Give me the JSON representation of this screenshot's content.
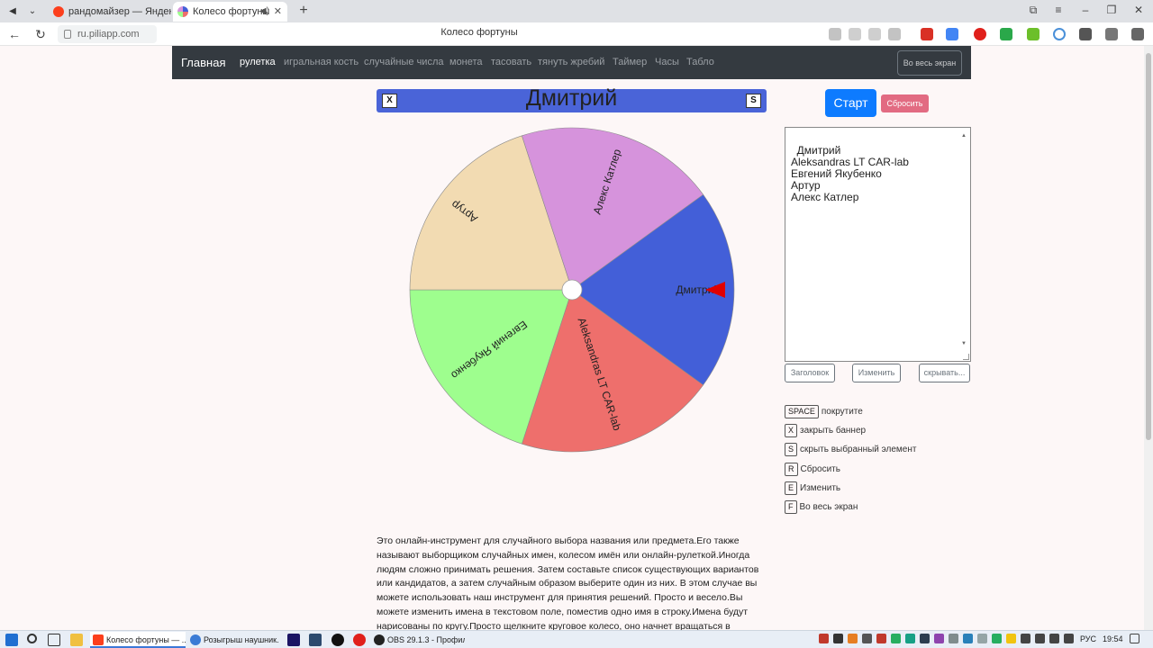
{
  "browser": {
    "tabs": [
      {
        "label": "рандомайзер — Яндекс: н"
      },
      {
        "label": "Колесо фортуны"
      }
    ],
    "url": "ru.piliapp.com",
    "page_title": "Колесо фортуны"
  },
  "nav": {
    "brand": "Главная",
    "links": [
      "рулетка",
      "игральная кость",
      "случайные числа",
      "монета",
      "тасовать",
      "тянуть жребий",
      "Таймер",
      "Часы",
      "Табло"
    ],
    "fullscreen": "Во весь экран"
  },
  "banner": {
    "close_key": "X",
    "winner": "Дмитрий",
    "hide_key": "S"
  },
  "wheel": {
    "segments": [
      {
        "name": "Дмитрий",
        "color": "#435fd8"
      },
      {
        "name": "Aleksandras LT CAR-lab",
        "color": "#ee6f6c"
      },
      {
        "name": "Евгений Якубенко",
        "color": "#9efe8e"
      },
      {
        "name": "Артур",
        "color": "#f2dbb2"
      },
      {
        "name": "Алекс Катлер",
        "color": "#d693dc"
      }
    ],
    "pointer_color": "#e00000"
  },
  "controls": {
    "start": "Старт",
    "reset": "Сбросить",
    "names_text": "Дмитрий\nAleksandras LT CAR-lab\nЕвгений Якубенко\nАртур\nАлекс Катлер",
    "title_btn": "Заголовок",
    "edit_btn": "Изменить",
    "hide_btn": "скрывать..."
  },
  "hotkeys": [
    {
      "key": "SPACE",
      "label": "покрутите"
    },
    {
      "key": "X",
      "label": "закрыть баннер"
    },
    {
      "key": "S",
      "label": "скрыть выбранный элемент"
    },
    {
      "key": "R",
      "label": "Сбросить"
    },
    {
      "key": "E",
      "label": "Изменить"
    },
    {
      "key": "F",
      "label": "Во весь экран"
    }
  ],
  "description": "Это онлайн-инструмент для случайного выбора названия или предмета.Его также называют выборщиком случайных имен, колесом имён или онлайн-рулеткой.Иногда людям сложно принимать решения. Затем составьте список существующих вариантов или кандидатов, а затем случайным образом выберите один из них. В этом случае вы можете использовать наш инструмент для принятия решений. Просто и весело.Вы можете изменить имена в текстовом поле, поместив одно имя в строку.Имена будут нарисованы по кругу.Просто щелкните круговое колесо, оно начнет вращаться в",
  "taskbar": {
    "apps": [
      "Колесо фортуны — ...",
      "Розыгрыш наушник...",
      "OBS 29.1.3 - Профил..."
    ],
    "lang": "РУС",
    "time": "19:54"
  }
}
